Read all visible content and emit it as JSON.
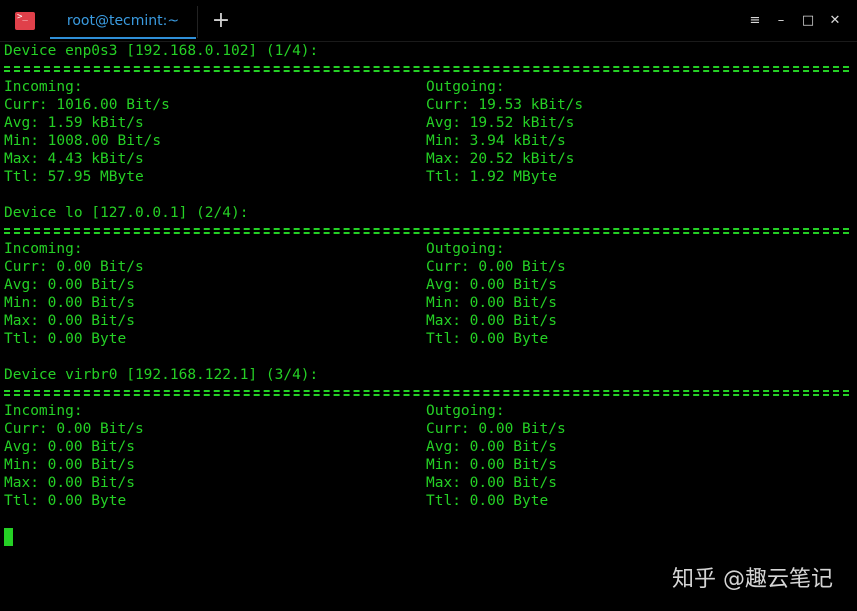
{
  "window": {
    "tab_title": "root@tecmint:~",
    "app_icon_glyph": ">_",
    "new_tab_glyph": "+",
    "menu_glyph": "≡",
    "minimize_glyph": "–",
    "maximize_glyph": "□",
    "close_glyph": "✕"
  },
  "devices": [
    {
      "header": "Device enp0s3 [192.168.0.102] (1/4):",
      "incoming": {
        "label": "Incoming:",
        "curr": "Curr: 1016.00 Bit/s",
        "avg": "Avg: 1.59 kBit/s",
        "min": "Min: 1008.00 Bit/s",
        "max": "Max: 4.43 kBit/s",
        "ttl": "Ttl: 57.95 MByte"
      },
      "outgoing": {
        "label": "Outgoing:",
        "curr": "Curr: 19.53 kBit/s",
        "avg": "Avg: 19.52 kBit/s",
        "min": "Min: 3.94 kBit/s",
        "max": "Max: 20.52 kBit/s",
        "ttl": "Ttl: 1.92 MByte"
      }
    },
    {
      "header": "Device lo [127.0.0.1] (2/4):",
      "incoming": {
        "label": "Incoming:",
        "curr": "Curr: 0.00 Bit/s",
        "avg": "Avg: 0.00 Bit/s",
        "min": "Min: 0.00 Bit/s",
        "max": "Max: 0.00 Bit/s",
        "ttl": "Ttl: 0.00 Byte"
      },
      "outgoing": {
        "label": "Outgoing:",
        "curr": "Curr: 0.00 Bit/s",
        "avg": "Avg: 0.00 Bit/s",
        "min": "Min: 0.00 Bit/s",
        "max": "Max: 0.00 Bit/s",
        "ttl": "Ttl: 0.00 Byte"
      }
    },
    {
      "header": "Device virbr0 [192.168.122.1] (3/4):",
      "incoming": {
        "label": "Incoming:",
        "curr": "Curr: 0.00 Bit/s",
        "avg": "Avg: 0.00 Bit/s",
        "min": "Min: 0.00 Bit/s",
        "max": "Max: 0.00 Bit/s",
        "ttl": "Ttl: 0.00 Byte"
      },
      "outgoing": {
        "label": "Outgoing:",
        "curr": "Curr: 0.00 Bit/s",
        "avg": "Avg: 0.00 Bit/s",
        "min": "Min: 0.00 Bit/s",
        "max": "Max: 0.00 Bit/s",
        "ttl": "Ttl: 0.00 Byte"
      }
    }
  ],
  "watermark": "知乎 @趣云笔记",
  "colors": {
    "background": "#000000",
    "terminal_text": "#25d025",
    "tab_accent": "#2f8fd8",
    "app_icon": "#e0404a"
  }
}
